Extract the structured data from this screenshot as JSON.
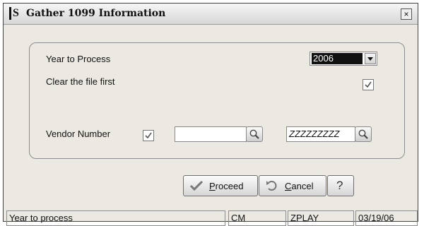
{
  "window": {
    "title": "Gather 1099 Information",
    "app_icon_letter": "S",
    "close_label": "×"
  },
  "form": {
    "year_label": "Year to Process",
    "year_value": "2006",
    "clear_label": "Clear the file first",
    "clear_checked": true,
    "vendor_label": "Vendor Number",
    "vendor_checked": true,
    "vendor_from_value": "",
    "vendor_to_value": "ZZZZZZZZZ"
  },
  "buttons": {
    "proceed_label_underlined": "P",
    "proceed_label_rest": "roceed",
    "cancel_label_underlined": "C",
    "cancel_label_rest": "ancel",
    "help_label": "?"
  },
  "statusbar": {
    "message": "Year to process",
    "company": "CM",
    "user": "ZPLAY",
    "date": "03/19/06"
  }
}
